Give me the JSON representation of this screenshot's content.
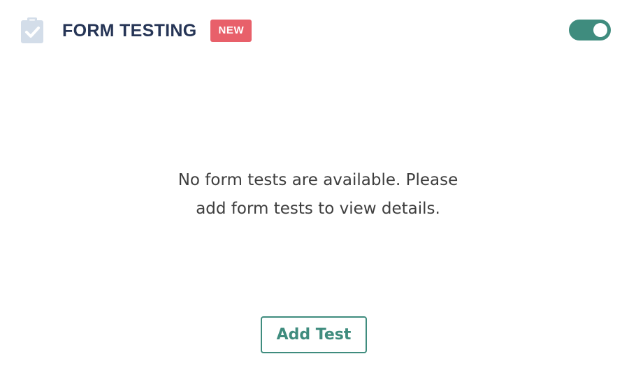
{
  "header": {
    "icon": "clipboard-check-icon",
    "title": "FORM TESTING",
    "badge": "NEW"
  },
  "toggle": {
    "state": "on"
  },
  "empty_state": {
    "line1": "No form tests are available. Please",
    "line2": "add form tests to view details."
  },
  "actions": {
    "add_test_label": "Add Test"
  },
  "colors": {
    "title": "#263556",
    "badge_background": "#e8606a",
    "accent": "#3f8c7e",
    "icon": "#d3dde9",
    "body_text": "#3e3e3e"
  }
}
